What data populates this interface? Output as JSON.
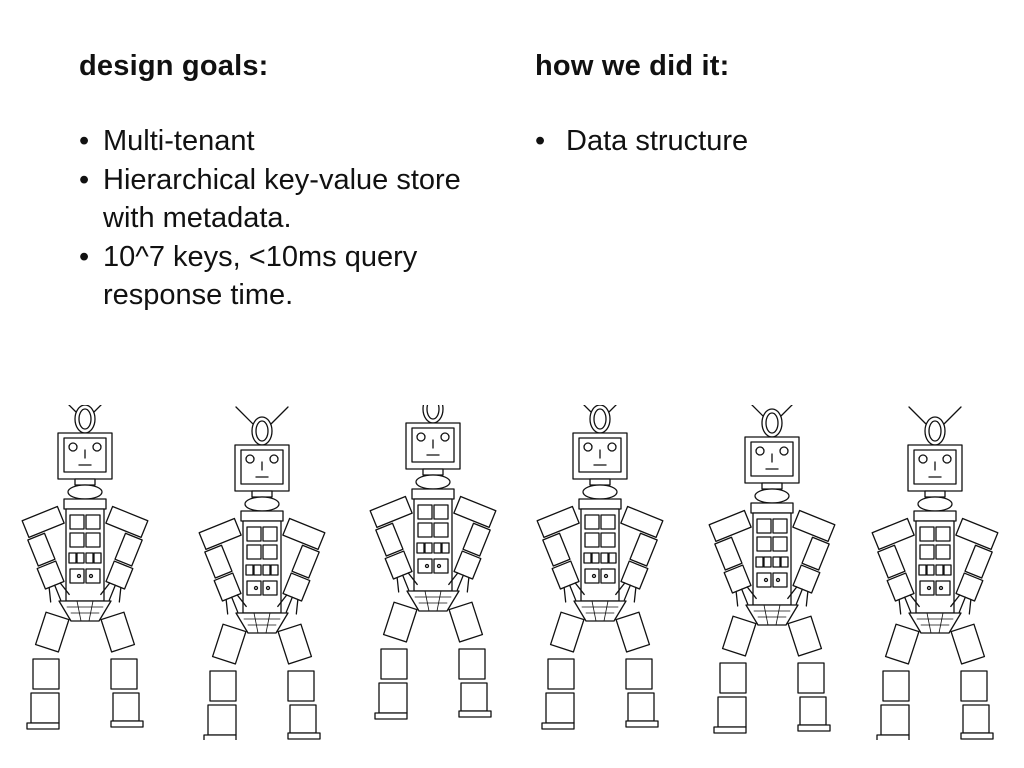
{
  "slide": {
    "left": {
      "heading": "design goals:",
      "bullets": [
        "Multi-tenant",
        "Hierarchical key-value store with metadata.",
        "10^7 keys, <10ms query response time."
      ]
    },
    "right": {
      "heading": "how we did it:",
      "bullets": [
        "Data structure"
      ]
    }
  },
  "illustration": {
    "subject": "robot",
    "count": 6,
    "stroke_color": "#111111",
    "fill_color": "#ffffff"
  }
}
